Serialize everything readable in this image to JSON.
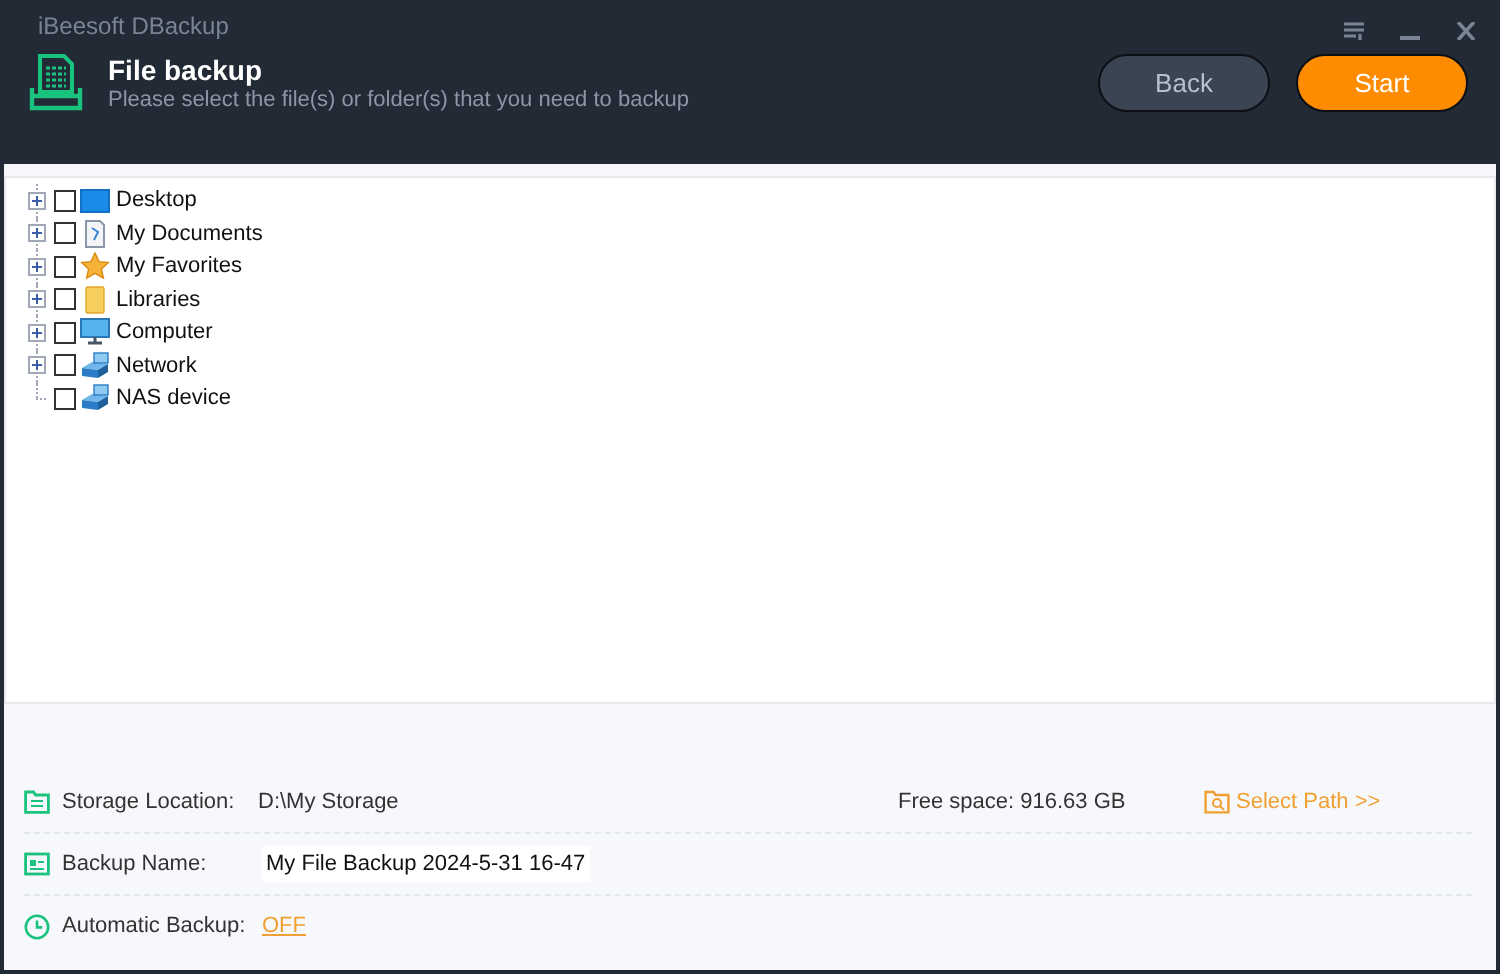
{
  "window": {
    "title": "iBeesoft DBackup"
  },
  "header": {
    "title": "File backup",
    "subtitle": "Please select the file(s) or folder(s) that you need to backup",
    "buttons": [
      {
        "label": "Back",
        "kind": "secondary"
      },
      {
        "label": "Start",
        "kind": "primary"
      }
    ]
  },
  "tree": {
    "items": [
      {
        "label": "Desktop",
        "kind": "desktop",
        "checked": false,
        "expandable": true
      },
      {
        "label": "My Documents",
        "kind": "documents",
        "checked": false,
        "expandable": true
      },
      {
        "label": "My Favorites",
        "kind": "favorites",
        "checked": false,
        "expandable": true
      },
      {
        "label": "Libraries",
        "kind": "libraries",
        "checked": false,
        "expandable": true
      },
      {
        "label": "Computer",
        "kind": "computer",
        "checked": false,
        "expandable": true
      },
      {
        "label": "Network",
        "kind": "network",
        "checked": false,
        "expandable": true
      },
      {
        "label": "NAS device",
        "kind": "network",
        "checked": false,
        "expandable": false
      }
    ]
  },
  "storage": {
    "label": "Storage Location:",
    "value": "D:\\My Storage",
    "free_space": "Free space: 916.63 GB",
    "select_path": "Select Path >>"
  },
  "backup_name": {
    "label": "Backup Name:",
    "value": "My File Backup 2024-5-31 16-47"
  },
  "automatic_backup": {
    "label": "Automatic Backup:",
    "value": "OFF"
  }
}
